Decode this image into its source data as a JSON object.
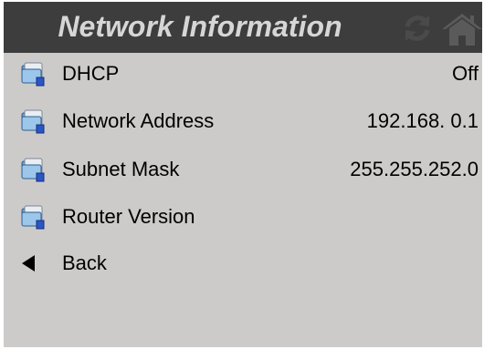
{
  "header": {
    "title": "Network Information",
    "refresh_icon": "refresh-icon",
    "home_icon": "home-icon"
  },
  "rows": [
    {
      "label": "DHCP",
      "value": "Off",
      "icon": "network-folder-icon"
    },
    {
      "label": "Network Address",
      "value": "192.168. 0.1",
      "icon": "network-folder-icon"
    },
    {
      "label": "Subnet Mask",
      "value": "255.255.252.0",
      "icon": "network-folder-icon"
    },
    {
      "label": "Router Version",
      "value": "",
      "icon": "network-folder-icon"
    }
  ],
  "back": {
    "label": "Back",
    "icon": "back-arrow-icon"
  },
  "colors": {
    "titlebar": "#3d3d3e",
    "title_text": "#d6d6d6",
    "background": "#cdcbca",
    "text": "#000000"
  }
}
